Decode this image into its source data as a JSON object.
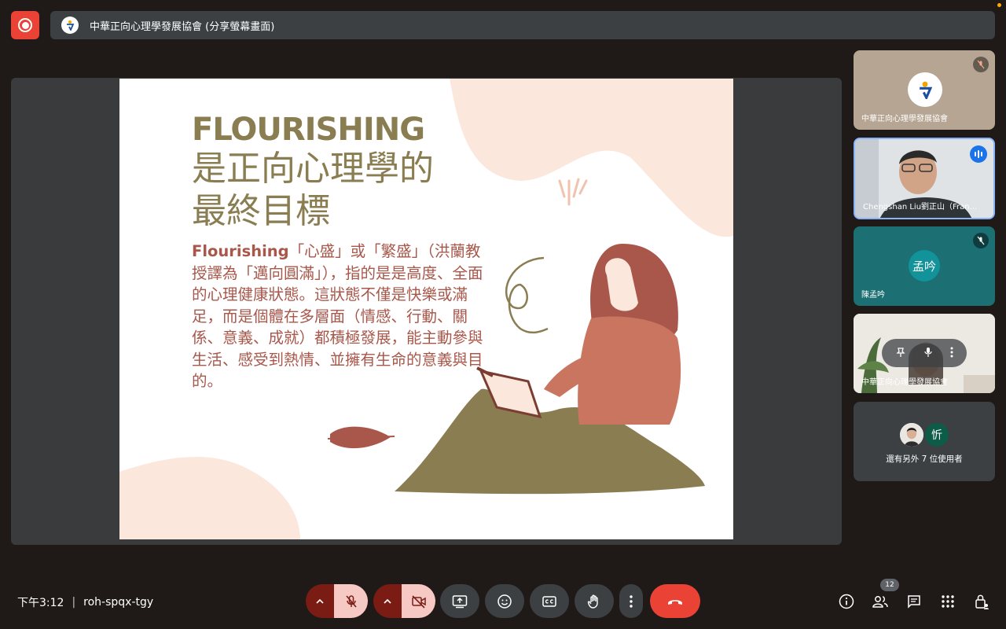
{
  "top_bar": {
    "share_title": "中華正向心理學發展協會 (分享螢幕畫面)"
  },
  "slide": {
    "title_en": "FLOURISHING",
    "title_zh_line1": "是正向心理學的",
    "title_zh_line2": "最終目標",
    "body_lead": "Flourishing",
    "body_text": "「心盛」或「繁盛」（洪蘭教授譯為「邁向圓滿」），指的是是高度、全面的心理健康狀態。這狀態不僅是快樂或滿足，而是個體在多層面（情感、行動、關係、意義、成就）都積極發展，能主動參與生活、感受到熱情、並擁有生命的意義與目的。"
  },
  "participants": [
    {
      "name": "中華正向心理學發展協會",
      "muted": true
    },
    {
      "name": "Chengshan Liu劉正山（Fran...",
      "speaking": true
    },
    {
      "name": "陳孟吟",
      "avatar_text": "孟吟",
      "avatar_color": "#12939a",
      "muted": true
    },
    {
      "name": "中華正向心理學發展協會"
    },
    {
      "others_text": "還有另外 7 位使用者",
      "avatar_text": "忻",
      "avatar_color": "#0d5c48"
    }
  ],
  "bottom_bar": {
    "time": "下午3:12",
    "separator": "|",
    "meeting_code": "roh-spqx-tgy",
    "people_count": "12"
  },
  "colors": {
    "record": "#ea4335",
    "leave": "#ea4335",
    "speaking": "#1a73e8",
    "slide_title": "#8a7d51",
    "slide_body": "#a8574a"
  }
}
